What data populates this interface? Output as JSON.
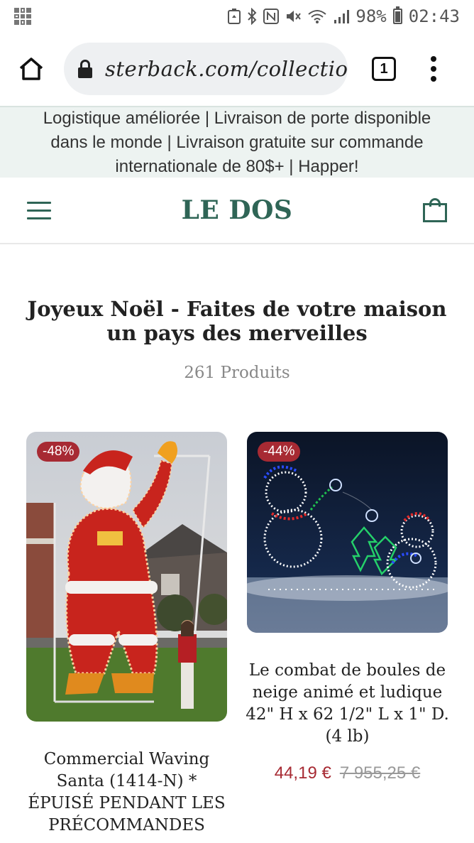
{
  "status_bar": {
    "battery": "98%",
    "time": "02:43",
    "icons": [
      "qr-code-icon",
      "data-saver-icon",
      "bluetooth-icon",
      "nfc-icon",
      "mute-icon",
      "wifi-icon",
      "signal-icon",
      "battery-icon"
    ]
  },
  "browser": {
    "url": "sterback.com/collectio",
    "tab_count": "1"
  },
  "announcement": {
    "text": "Logistique améliorée | Livraison de porte disponible dans le monde | Livraison gratuite sur commande internationale de 80$+ | Happer!"
  },
  "header": {
    "brand": "LE DOS"
  },
  "collection": {
    "title": "Joyeux Noël - Faites de votre maison un pays des merveilles",
    "count": "261 Produits"
  },
  "products": [
    {
      "badge": "-48%",
      "title": "Commercial Waving Santa (1414-N) * ÉPUISÉ PENDANT LES PRÉCOMMANDES"
    },
    {
      "badge": "-44%",
      "title": "Le combat de boules de neige animé et ludique 42\" H x 62 1/2\" L x 1\" D. (4 lb)",
      "price_sale": "44,19 €",
      "price_original": "7 955,25 €"
    }
  ],
  "colors": {
    "brand_green": "#2f6556",
    "sale_red": "#a72a33",
    "announcement_bg": "#edf3f1"
  }
}
